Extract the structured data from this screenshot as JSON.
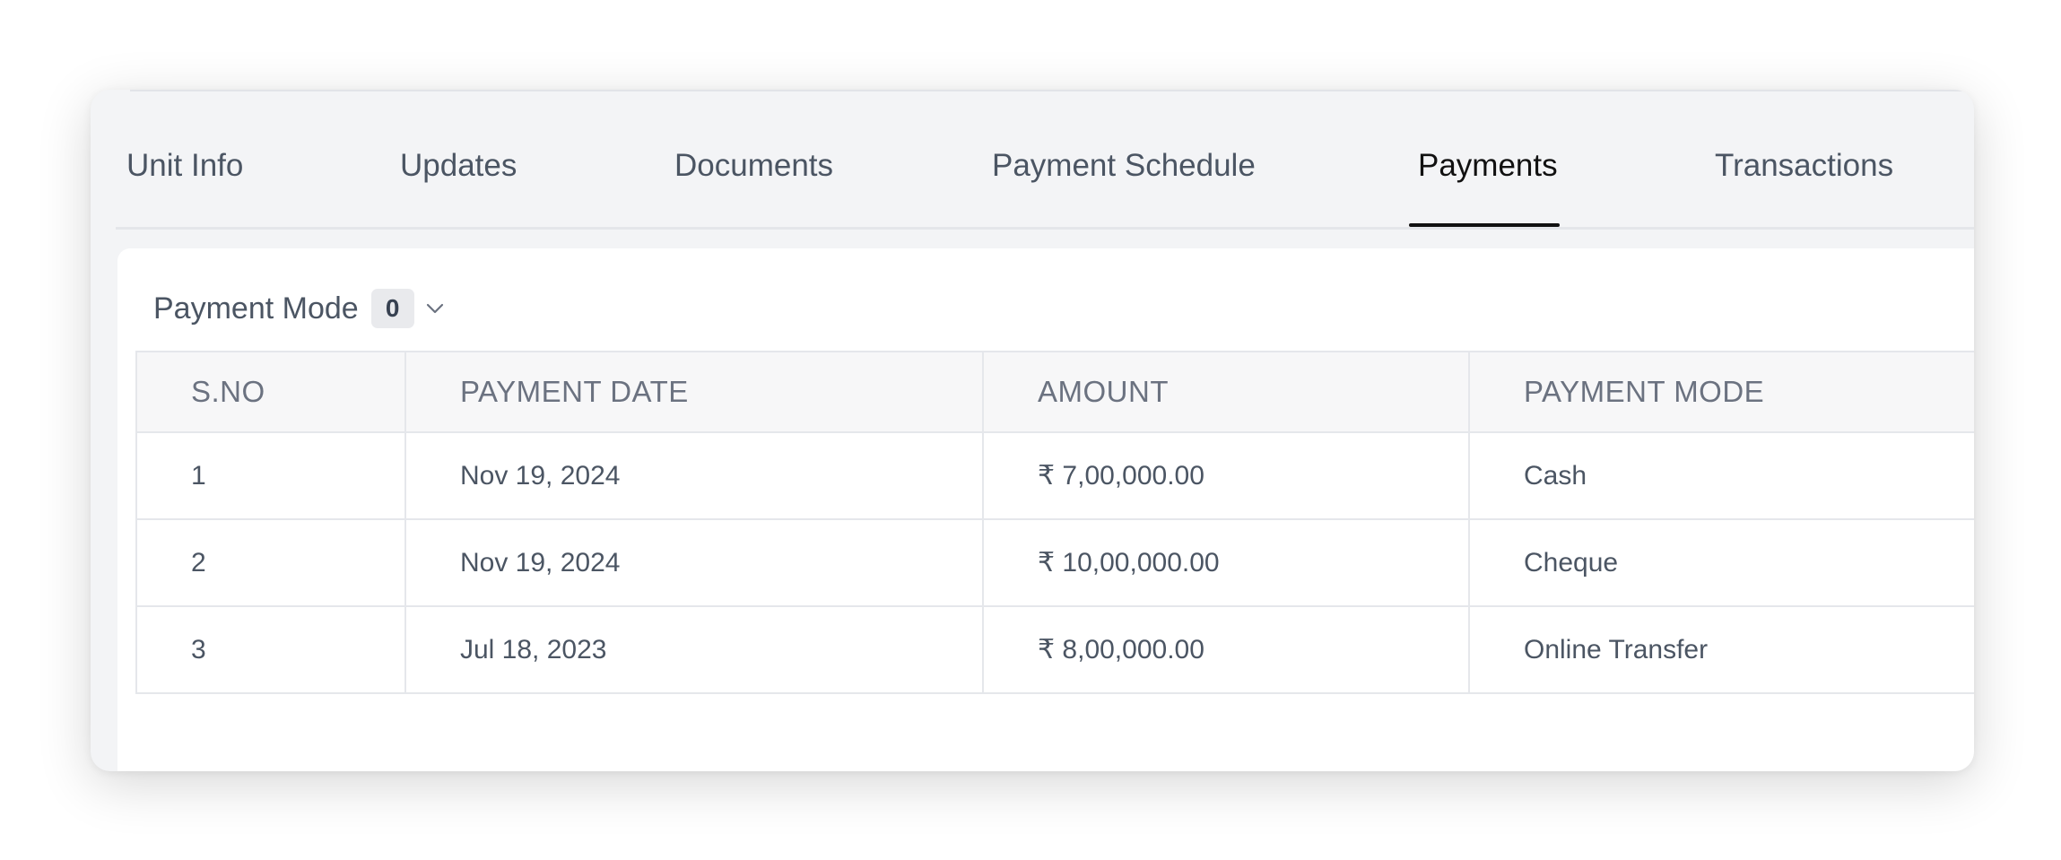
{
  "tabs": [
    {
      "label": "Unit Info",
      "active": false
    },
    {
      "label": "Updates",
      "active": false
    },
    {
      "label": "Documents",
      "active": false
    },
    {
      "label": "Payment Schedule",
      "active": false
    },
    {
      "label": "Payments",
      "active": true
    },
    {
      "label": "Transactions",
      "active": false
    }
  ],
  "filter": {
    "label": "Payment Mode",
    "count": "0",
    "icon": "chevron-down-icon"
  },
  "table": {
    "columns": [
      "S.NO",
      "PAYMENT DATE",
      "AMOUNT",
      "PAYMENT MODE"
    ],
    "rows": [
      [
        "1",
        "Nov 19, 2024",
        "₹ 7,00,000.00",
        "Cash"
      ],
      [
        "2",
        "Nov 19, 2024",
        "₹ 10,00,000.00",
        "Cheque"
      ],
      [
        "3",
        "Jul 18, 2023",
        "₹ 8,00,000.00",
        "Online Transfer"
      ]
    ]
  },
  "colors": {
    "active_tab": "#111111",
    "tab_text": "#4b5563",
    "card_background": "#f3f4f6",
    "table_border": "#e5e7eb"
  }
}
